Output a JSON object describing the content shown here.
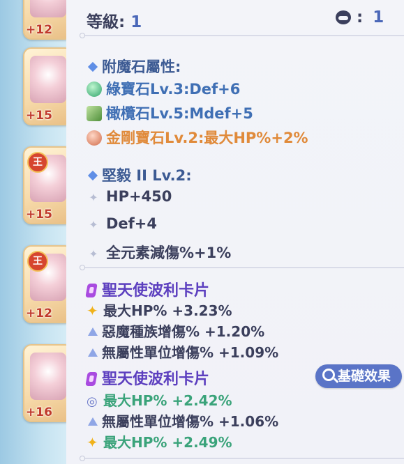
{
  "inventory": [
    {
      "level": "+12"
    },
    {
      "level": "+15"
    },
    {
      "level": "+15",
      "badge": "王"
    },
    {
      "level": "+12",
      "badge": "王"
    },
    {
      "level": "+16"
    }
  ],
  "header": {
    "level_label": "等級:",
    "level_value": "1",
    "slots_label": ":",
    "slots_value": "1"
  },
  "enchant": {
    "title": "附魔石屬性:",
    "gems": [
      {
        "text": "綠寶石Lv.3:Def+6",
        "color": "#3f6fb4"
      },
      {
        "text": "橄欖石Lv.5:Mdef+5",
        "color": "#3f6fb4"
      },
      {
        "text": "金剛寶石Lv.2:最大HP%+2%",
        "color": "#e08a3a"
      }
    ]
  },
  "skill": {
    "title": "堅毅 II Lv.2:",
    "lines": [
      "HP+450",
      "Def+4",
      "全元素減傷%+1%"
    ]
  },
  "cards": [
    {
      "name": "聖天使波利卡片",
      "effects": [
        {
          "text": "最大HP% +3.23%",
          "icon": "star-icon",
          "color": "#3b3f5c"
        },
        {
          "text": "惡魔種族增傷% +1.20%",
          "icon": "triangle-icon",
          "color": "#3b3f5c"
        },
        {
          "text": "無屬性單位增傷% +1.09%",
          "icon": "triangle-icon",
          "color": "#3b3f5c"
        }
      ]
    },
    {
      "name": "聖天使波利卡片",
      "effects": [
        {
          "text": "最大HP% +2.42%",
          "icon": "swirl-icon",
          "color": "#3aa37a"
        },
        {
          "text": "無屬性單位增傷% +1.06%",
          "icon": "triangle-icon",
          "color": "#3b3f5c"
        },
        {
          "text": "最大HP% +2.49%",
          "icon": "star-icon",
          "color": "#3aa37a"
        }
      ]
    }
  ],
  "base_effect_button": "基礎效果"
}
